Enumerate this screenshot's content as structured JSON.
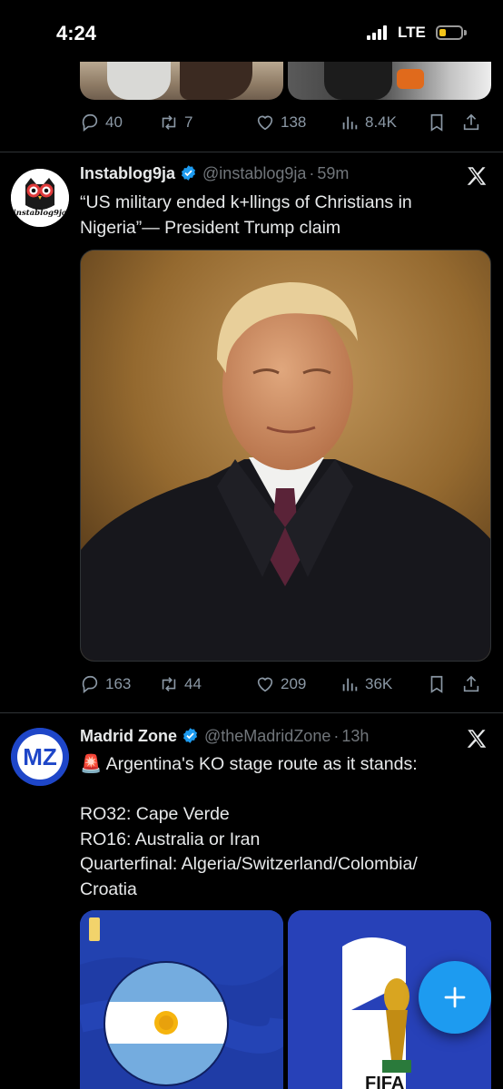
{
  "status_bar": {
    "time": "4:24",
    "network": "LTE"
  },
  "tweets": [
    {
      "stats": {
        "replies": "40",
        "reposts": "7",
        "likes": "138",
        "views": "8.4K"
      }
    },
    {
      "name": "Instablog9ja",
      "handle": "@instablog9ja",
      "time_sep": "·",
      "time": "59m",
      "avatar_text": "instablog9ja",
      "text": "“US military ended k+llings of Christians in Nigeria”— President Trump claim",
      "stats": {
        "replies": "163",
        "reposts": "44",
        "likes": "209",
        "views": "36K"
      }
    },
    {
      "name": "Madrid Zone",
      "handle": "@theMadridZone",
      "time_sep": "·",
      "time": "13h",
      "avatar_text": "MZ",
      "emoji": "🚨",
      "text_first": "Argentina's KO stage route as it stands:",
      "text_body": "RO32: Cape Verde\nRO16: Australia or Iran\nQuarterfinal: Algeria/Switzerland/Colombia/\nCroatia",
      "card_right_text": "FIFA"
    }
  ],
  "colors": {
    "accent": "#1d9bf0",
    "muted": "#71767b",
    "icon": "#8b98a5",
    "background": "#000000"
  },
  "icons": [
    "reply-icon",
    "repost-icon",
    "like-icon",
    "views-icon",
    "bookmark-icon",
    "share-icon",
    "verified-icon",
    "x-logo-icon",
    "compose-plus-icon"
  ]
}
